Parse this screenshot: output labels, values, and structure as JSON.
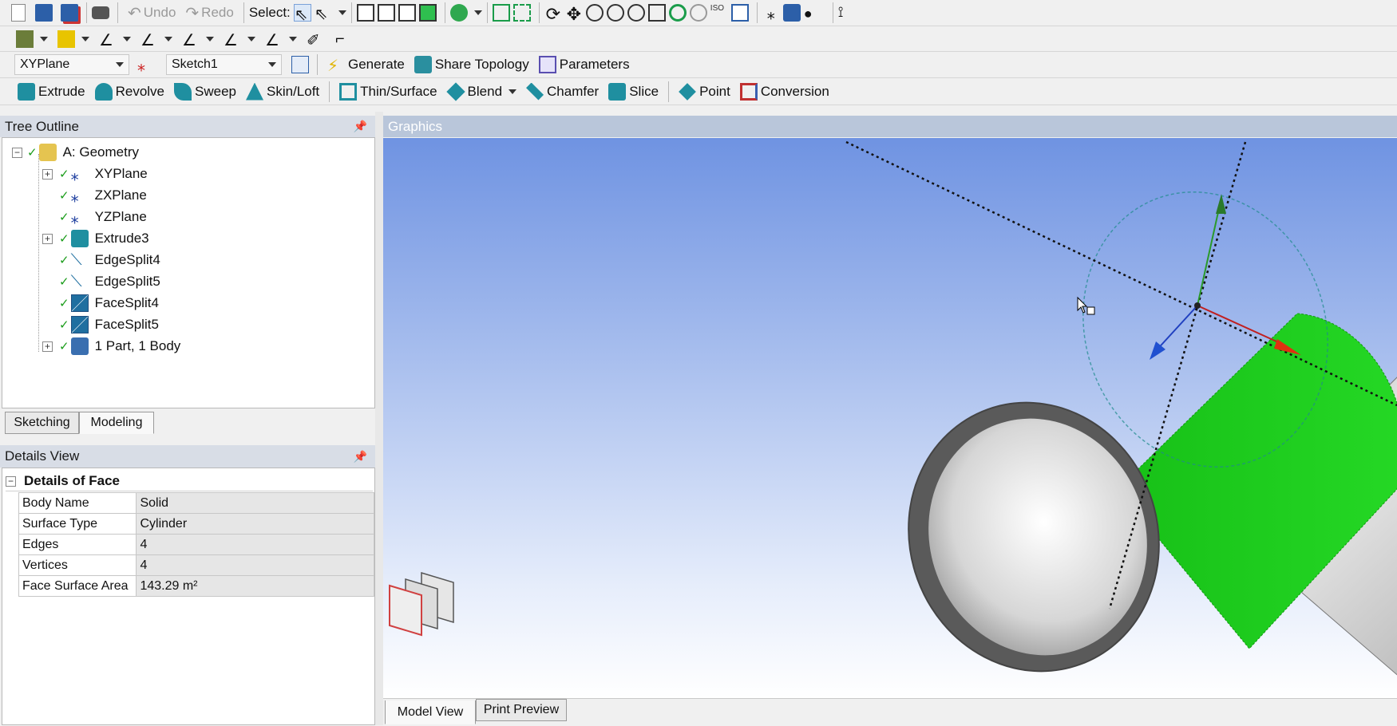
{
  "toolbar1": {
    "undo_label": "Undo",
    "redo_label": "Redo",
    "select_label": "Select:"
  },
  "toolbar3": {
    "plane_combo": "XYPlane",
    "sketch_combo": "Sketch1",
    "generate_label": "Generate",
    "share_topology_label": "Share Topology",
    "parameters_label": "Parameters"
  },
  "toolbar4": {
    "extrude_label": "Extrude",
    "revolve_label": "Revolve",
    "sweep_label": "Sweep",
    "skinloft_label": "Skin/Loft",
    "thinsurface_label": "Thin/Surface",
    "blend_label": "Blend",
    "chamfer_label": "Chamfer",
    "slice_label": "Slice",
    "point_label": "Point",
    "conversion_label": "Conversion"
  },
  "tree": {
    "header": "Tree Outline",
    "root": "A: Geometry",
    "items": [
      {
        "label": "XYPlane"
      },
      {
        "label": "ZXPlane"
      },
      {
        "label": "YZPlane"
      },
      {
        "label": "Extrude3"
      },
      {
        "label": "EdgeSplit4"
      },
      {
        "label": "EdgeSplit5"
      },
      {
        "label": "FaceSplit4"
      },
      {
        "label": "FaceSplit5"
      },
      {
        "label": "1 Part, 1 Body"
      }
    ]
  },
  "tabs": {
    "sketching": "Sketching",
    "modeling": "Modeling"
  },
  "details": {
    "header": "Details View",
    "group_title": "Details of Face",
    "rows": [
      {
        "key": "Body Name",
        "value": "Solid"
      },
      {
        "key": "Surface Type",
        "value": "Cylinder"
      },
      {
        "key": "Edges",
        "value": "4"
      },
      {
        "key": "Vertices",
        "value": "4"
      },
      {
        "key": "Face Surface Area",
        "value": "143.29 m²"
      }
    ]
  },
  "graphics": {
    "header": "Graphics",
    "tab_model_view": "Model View",
    "tab_print_preview": "Print Preview"
  },
  "colors": {
    "selected_face": "#1fcf1f",
    "panel_header": "#d8dde6",
    "viewport_top": "#6f93e2",
    "viewport_bottom": "#ffffff"
  }
}
